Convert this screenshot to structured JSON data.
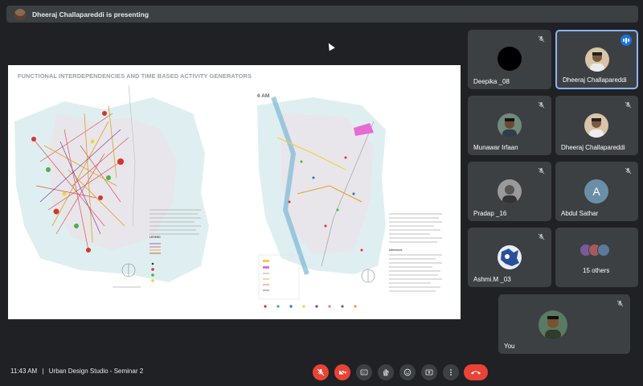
{
  "banner": {
    "presenting_text": "Dheeraj Challapareddi is presenting"
  },
  "slide": {
    "title": "FUNCTIONAL INTERDEPENDENCIES AND TIME BASED ACTIVITY GENERATORS",
    "time_label": "6 AM",
    "left_legend_heading": "LEGEND",
    "right_subheading": "Inferences"
  },
  "participants": [
    {
      "name": "Deepika _08",
      "muted": true
    },
    {
      "name": "Dheeraj Challapareddi",
      "muted": false,
      "speaking": true
    },
    {
      "name": "Munawar Irfaan",
      "muted": true
    },
    {
      "name": "Dheeraj Challapareddi",
      "muted": true
    },
    {
      "name": "Pradap _16",
      "muted": true
    },
    {
      "name": "Abdul Sathar",
      "muted": true,
      "initial": "A"
    },
    {
      "name": "Ashmi.M _03",
      "muted": true
    },
    {
      "name": "15 others"
    },
    {
      "name": "You",
      "muted": true
    }
  ],
  "bottom": {
    "time": "11:43 AM",
    "separator": "|",
    "meeting_name": "Urban Design Studio - Seminar 2"
  },
  "colors": {
    "background": "#202124",
    "tile": "#3c4043",
    "accent": "#8ab4f8",
    "danger": "#ea4335"
  }
}
